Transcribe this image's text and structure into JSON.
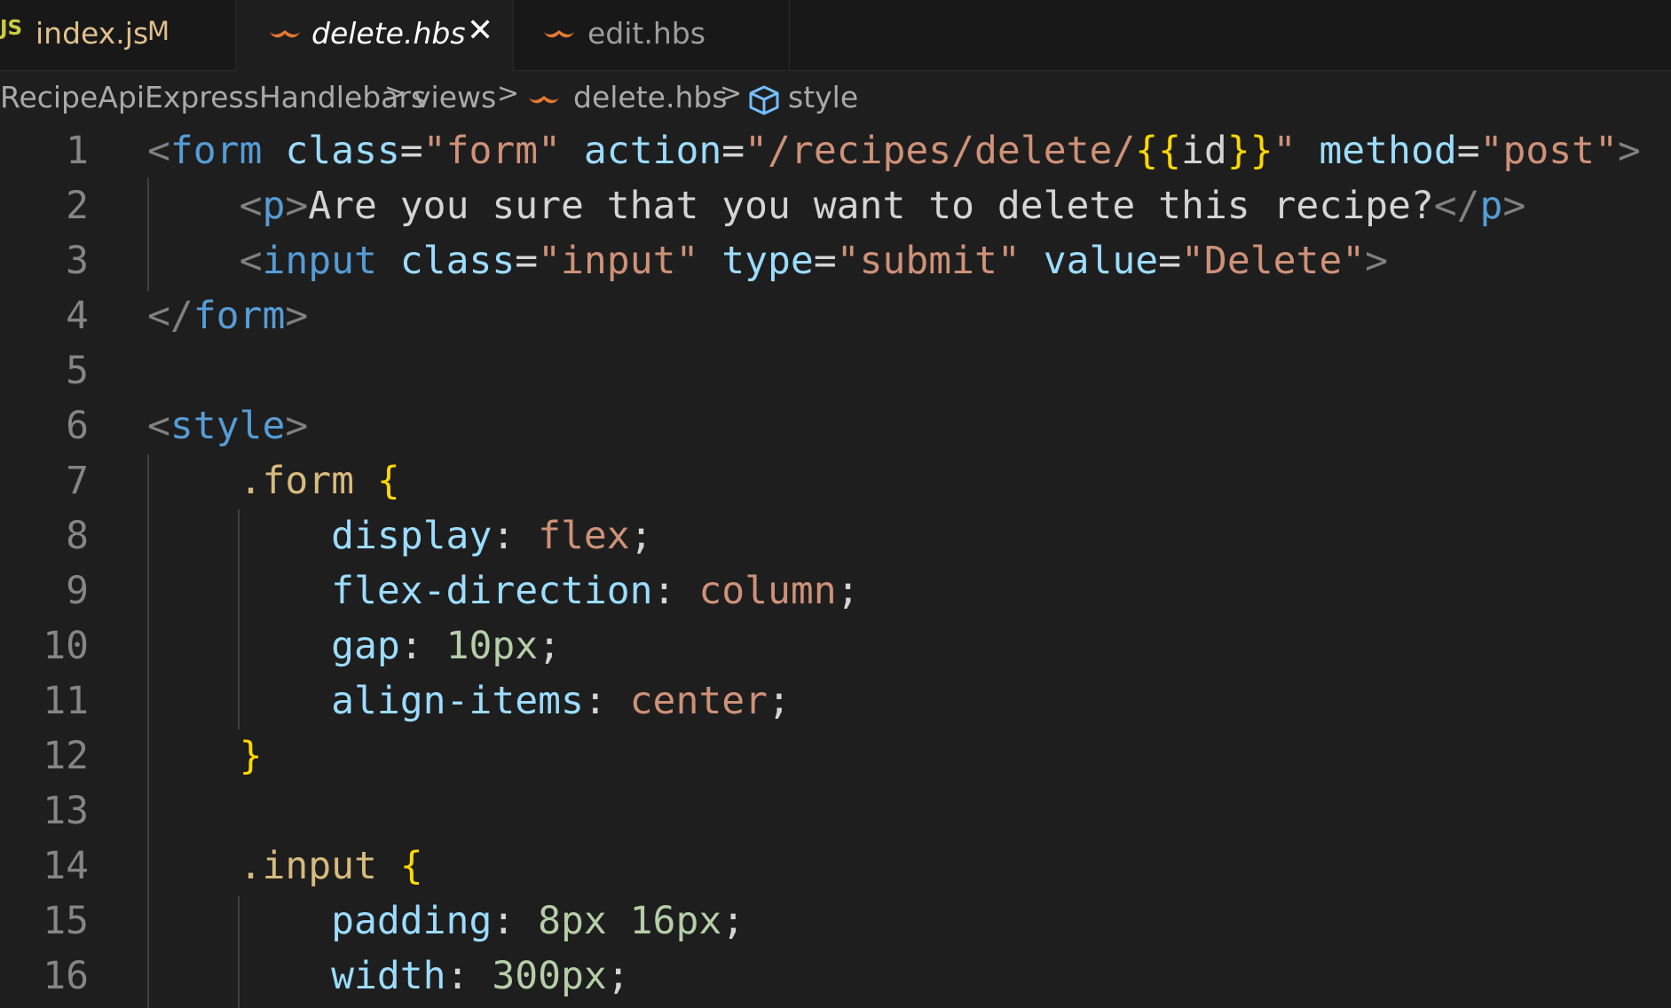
{
  "tabs": [
    {
      "badge": "JS",
      "label": "index.js",
      "status": "M"
    },
    {
      "label": "delete.hbs",
      "close": "✕"
    },
    {
      "label": "edit.hbs"
    }
  ],
  "breadcrumb": {
    "items": [
      "RecipeApiExpressHandlebars",
      "views",
      "delete.hbs",
      "style"
    ],
    "separator": ">"
  },
  "colors": {
    "tag": "#569cd6",
    "attribute": "#9cdcfe",
    "string": "#ce9178",
    "number": "#b5cea8",
    "brace": "#ffd700",
    "hbs_icon": "#e37933"
  },
  "editor": {
    "line_numbers": [
      "1",
      "2",
      "3",
      "4",
      "5",
      "6",
      "7",
      "8",
      "9",
      "10",
      "11",
      "12",
      "13",
      "14",
      "15",
      "16"
    ],
    "lines": [
      "<form class=\"form\" action=\"/recipes/delete/{{id}}\" method=\"post\">",
      "    <p>Are you sure that you want to delete this recipe?</p>",
      "    <input class=\"input\" type=\"submit\" value=\"Delete\">",
      "</form>",
      "",
      "<style>",
      "    .form {",
      "        display: flex;",
      "        flex-direction: column;",
      "        gap: 10px;",
      "        align-items: center;",
      "    }",
      "",
      "    .input {",
      "        padding: 8px 16px;",
      "        width: 300px;"
    ]
  }
}
